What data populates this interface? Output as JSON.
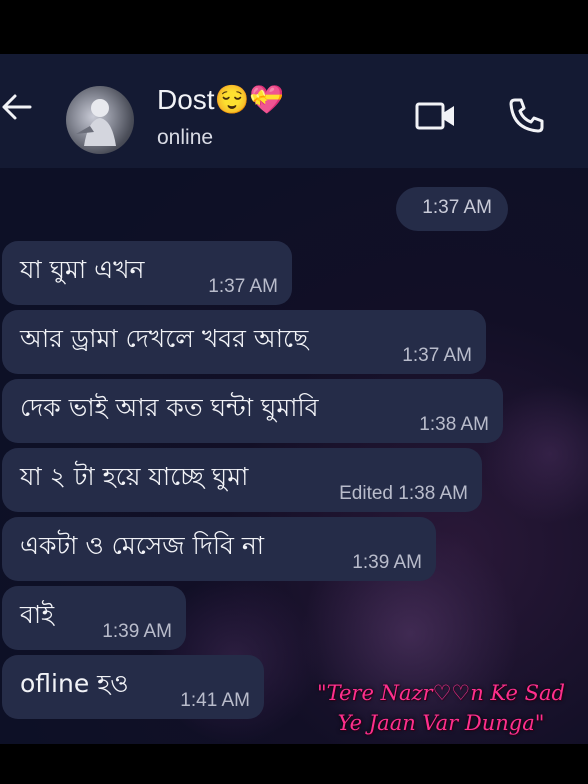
{
  "header": {
    "contact_name": "Dost😌💝",
    "status": "online",
    "back_icon": "arrow-left-icon",
    "video_icon": "video-camera-icon",
    "call_icon": "phone-icon"
  },
  "chat": {
    "top_bubble_time": "1:37 AM",
    "messages": [
      {
        "text": "যা ঘুমা এখন",
        "time": "1:37 AM"
      },
      {
        "text": "আর ড্রামা দেখলে খবর আছে",
        "time": "1:37 AM"
      },
      {
        "text": "দেক ভাই আর কত ঘন্টা ঘুমাবি",
        "time": "1:38 AM"
      },
      {
        "text": "যা ২ টা হয়ে যাচ্ছে ঘুমা",
        "time": "Edited 1:38 AM"
      },
      {
        "text": "একটা ও মেসেজ দিবি না",
        "time": "1:39 AM"
      },
      {
        "text": "বাই",
        "time": "1:39 AM"
      },
      {
        "text": "ofline হও",
        "time": "1:41 AM"
      }
    ]
  },
  "overlay": {
    "line1": "\"Tere Nazr♡♡n Ke Sad",
    "line2": "Ye Jaan Var Dunga\""
  },
  "colors": {
    "header_bg": "#141a33",
    "bubble_bg": "#252c48",
    "lyrics": "#ff2f8c"
  }
}
